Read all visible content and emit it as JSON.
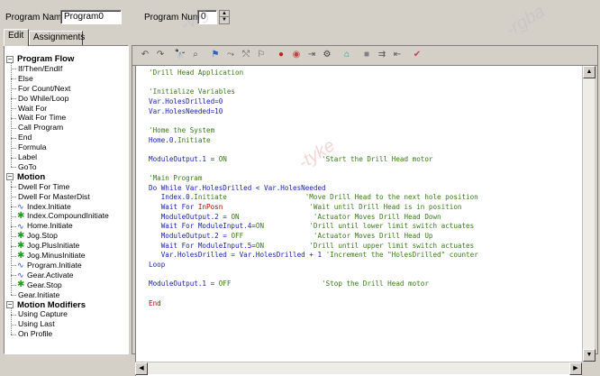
{
  "header": {
    "program_name_label": "Program Name",
    "program_name_value": "Program0",
    "program_number_label": "Program Number",
    "program_number_value": "0"
  },
  "tabs": [
    {
      "label": "Edit",
      "active": true
    },
    {
      "label": "Assignments",
      "active": false
    }
  ],
  "tree": {
    "groups": [
      {
        "label": "Program Flow",
        "items": [
          {
            "label": "If/Then/EndIf",
            "icon": ""
          },
          {
            "label": "Else",
            "icon": ""
          },
          {
            "label": "For Count/Next",
            "icon": ""
          },
          {
            "label": "Do While/Loop",
            "icon": ""
          },
          {
            "label": "Wait For",
            "icon": ""
          },
          {
            "label": "Wait For Time",
            "icon": ""
          },
          {
            "label": "Call Program",
            "icon": ""
          },
          {
            "label": "End",
            "icon": ""
          },
          {
            "label": "Formula",
            "icon": ""
          },
          {
            "label": "Label",
            "icon": ""
          },
          {
            "label": "GoTo",
            "icon": ""
          }
        ]
      },
      {
        "label": "Motion",
        "items": [
          {
            "label": "Dwell For Time",
            "icon": ""
          },
          {
            "label": "Dwell For MasterDist",
            "icon": ""
          },
          {
            "label": "Index.Initiate",
            "icon": "wave-icon"
          },
          {
            "label": "Index.CompoundInitiate",
            "icon": "gear-icon"
          },
          {
            "label": "Home.Initiate",
            "icon": "wave-icon"
          },
          {
            "label": "Jog.Stop",
            "icon": "gear-icon"
          },
          {
            "label": "Jog.PlusInitiate",
            "icon": "gear-icon"
          },
          {
            "label": "Jog.MinusInitiate",
            "icon": "gear-icon"
          },
          {
            "label": "Program.Initiate",
            "icon": "wave-icon"
          },
          {
            "label": "Gear.Activate",
            "icon": "wave-icon"
          },
          {
            "label": "Gear.Stop",
            "icon": "gear-icon"
          },
          {
            "label": "Gear.Initiate",
            "icon": ""
          }
        ]
      },
      {
        "label": "Motion Modifiers",
        "items": [
          {
            "label": "Using Capture",
            "icon": ""
          },
          {
            "label": "Using Last",
            "icon": ""
          },
          {
            "label": "On Profile",
            "icon": ""
          }
        ]
      }
    ]
  },
  "toolbar": {
    "buttons": [
      "undo-icon",
      "redo-icon",
      "find-icon",
      "find-next-icon",
      "bookmark-icon",
      "bookmark-next-icon",
      "bookmark-prev-icon",
      "bookmark-clear-icon",
      "breakpoint-icon",
      "breakpoint-clear-icon",
      "step-icon",
      "run-icon",
      "home-icon",
      "stop-icon",
      "step-over-icon",
      "step-out-icon",
      "check-icon"
    ]
  },
  "code": [
    [
      {
        "t": "'Drill Head Application",
        "c": "cmt"
      }
    ],
    [],
    [
      {
        "t": "'Initialize Variables",
        "c": "cmt"
      }
    ],
    [
      {
        "t": "Var.HolesDrilled=0",
        "c": "kw"
      }
    ],
    [
      {
        "t": "Var.HolesNeeded=10",
        "c": "kw"
      }
    ],
    [],
    [
      {
        "t": "'Home the System",
        "c": "cmt"
      }
    ],
    [
      {
        "t": "Home.0.",
        "c": "kw"
      },
      {
        "t": "Initiate",
        "c": "cmt"
      }
    ],
    [],
    [
      {
        "t": "ModuleOutput.1 = ",
        "c": "kw"
      },
      {
        "t": "ON",
        "c": "cmt"
      },
      {
        "t": "                       'Start the Drill Head motor",
        "c": "cmt"
      }
    ],
    [],
    [
      {
        "t": "'Main Program",
        "c": "cmt"
      }
    ],
    [
      {
        "t": "Do While ",
        "c": "kw"
      },
      {
        "t": "Var.HolesDrilled < Var.HolesNeeded",
        "c": "kw"
      }
    ],
    [
      {
        "t": "   Index.0.",
        "c": "kw"
      },
      {
        "t": "Initiate",
        "c": "cmt"
      },
      {
        "t": "                   'Move Drill Head to the next hole position",
        "c": "cmt"
      }
    ],
    [
      {
        "t": "   Wait For ",
        "c": "kw"
      },
      {
        "t": "InPosn",
        "c": "str"
      },
      {
        "t": "                     'Wait until Drill Head is in position",
        "c": "cmt"
      }
    ],
    [
      {
        "t": "   ModuleOutput.2 = ",
        "c": "kw"
      },
      {
        "t": "ON",
        "c": "cmt"
      },
      {
        "t": "                  'Actuator Moves Drill Head Down",
        "c": "cmt"
      }
    ],
    [
      {
        "t": "   Wait For ModuleInput.4=",
        "c": "kw"
      },
      {
        "t": "ON",
        "c": "cmt"
      },
      {
        "t": "           'Drill until lower limit switch actuates",
        "c": "cmt"
      }
    ],
    [
      {
        "t": "   ModuleOutput.2 = ",
        "c": "kw"
      },
      {
        "t": "OFF",
        "c": "cmt"
      },
      {
        "t": "                 'Actuator Moves Drill Head Up",
        "c": "cmt"
      }
    ],
    [
      {
        "t": "   Wait For ModuleInput.5=",
        "c": "kw"
      },
      {
        "t": "ON",
        "c": "cmt"
      },
      {
        "t": "           'Drill until upper limit switch actuates",
        "c": "cmt"
      }
    ],
    [
      {
        "t": "   Var.HolesDrilled = Var.HolesDrilled + 1",
        "c": "kw"
      },
      {
        "t": " 'Increment the \"HolesDrilled\" counter",
        "c": "cmt"
      }
    ],
    [
      {
        "t": "Loop",
        "c": "kw"
      }
    ],
    [],
    [
      {
        "t": "ModuleOutput.1 = ",
        "c": "kw"
      },
      {
        "t": "OFF",
        "c": "cmt"
      },
      {
        "t": "                      'Stop the Drill Head motor",
        "c": "cmt"
      }
    ],
    [],
    [
      {
        "t": "End",
        "c": "str"
      }
    ]
  ],
  "colors": {
    "comment": "#3a7a18",
    "keyword": "#1c22a8",
    "string": "#b40000",
    "window_bg": "#d4d0c8"
  }
}
